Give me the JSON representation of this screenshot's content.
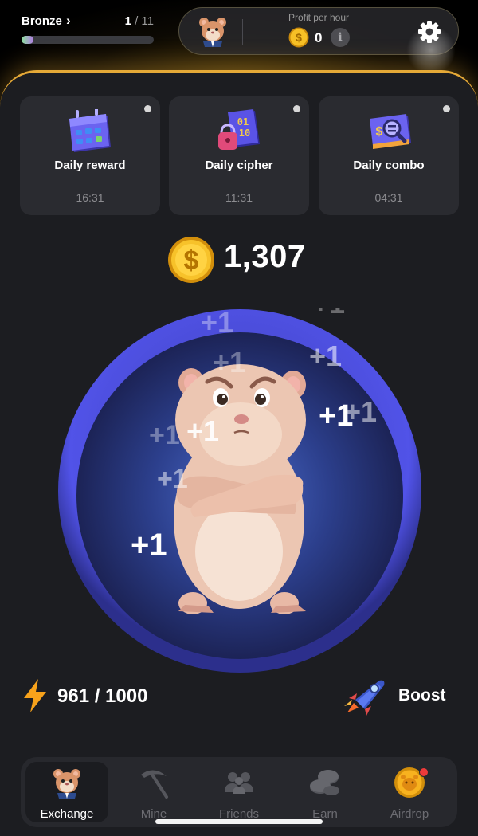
{
  "level": {
    "name": "Bronze",
    "chevron": "›",
    "current": "1",
    "total": " / 11",
    "progress_fraction": 0.09
  },
  "profit": {
    "label": "Profit per hour",
    "value": "0",
    "info_glyph": "i"
  },
  "daily": [
    {
      "title": "Daily reward",
      "time": "16:31",
      "icon": "calendar-icon"
    },
    {
      "title": "Daily cipher",
      "time": "11:31",
      "icon": "cipher-icon"
    },
    {
      "title": "Daily combo",
      "time": "04:31",
      "icon": "combo-icon"
    }
  ],
  "balance": {
    "value": "1,307",
    "coin_symbol": "$"
  },
  "tap_feedback": "+1",
  "energy": {
    "value": "961 / 1000",
    "current": 961,
    "max": 1000
  },
  "boost": {
    "label": "Boost"
  },
  "nav": [
    {
      "label": "Exchange",
      "icon": "hamster-icon",
      "active": true
    },
    {
      "label": "Mine",
      "icon": "pickaxe-icon",
      "active": false
    },
    {
      "label": "Friends",
      "icon": "friends-icon",
      "active": false
    },
    {
      "label": "Earn",
      "icon": "coins-icon",
      "active": false
    },
    {
      "label": "Airdrop",
      "icon": "airdrop-coin-icon",
      "active": false,
      "badge": true
    }
  ],
  "colors": {
    "accent_gold": "#e5a937",
    "panel_bg": "#1c1d21",
    "card_bg": "#2a2b30",
    "circle_ring": "#4b4ee0",
    "badge_red": "#ee3a3a"
  }
}
